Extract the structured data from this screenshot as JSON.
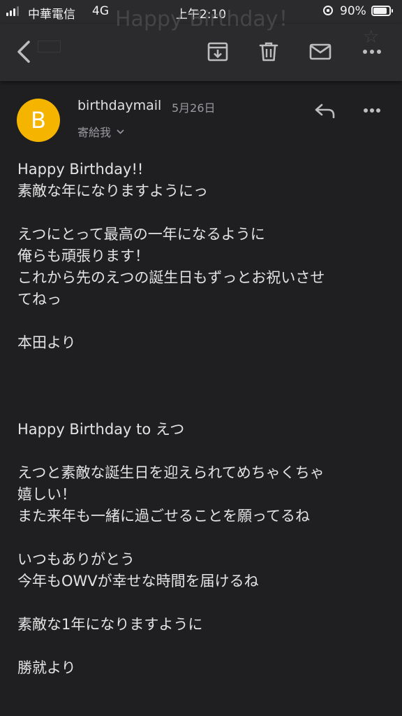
{
  "status_bar": {
    "carrier": "中華電信",
    "network": "4G",
    "time": "上午2:10",
    "battery": "90%"
  },
  "background_title": {
    "subject": "Happy Birthday！"
  },
  "toolbar": {
    "back": "back-arrow-icon",
    "archive": "archive-icon",
    "delete": "trash-icon",
    "mark_unread": "mail-icon",
    "more": "more-horizontal-icon"
  },
  "message": {
    "avatar_letter": "B",
    "avatar_color": "#f4b400",
    "sender": "birthdaymail",
    "date": "5月26日",
    "recipient": "寄給我",
    "body_lines": [
      "Happy Birthday!!",
      "素敵な年になりますようにっ",
      "",
      "えつにとって最高の一年になるように",
      "俺らも頑張ります！",
      "これから先のえつの誕生日もずっとお祝いさせ",
      "てねっ",
      "",
      "本田より",
      "",
      "",
      "",
      "Happy Birthday to えつ",
      "",
      "えつと素敵な誕生日を迎えられてめちゃくちゃ",
      "嬉しい！",
      "また来年も一緒に過ごせることを願ってるね",
      "",
      "いつもありがとう",
      "今年もOWVが幸せな時間を届けるね",
      "",
      "素敵な1年になりますように",
      "",
      "勝就より"
    ]
  },
  "colors": {
    "background": "#1f1f21",
    "toolbar": "#2b2b2d",
    "text": "#e3e3e3",
    "muted": "#9a9a9e",
    "icon": "#bdbdbd"
  }
}
